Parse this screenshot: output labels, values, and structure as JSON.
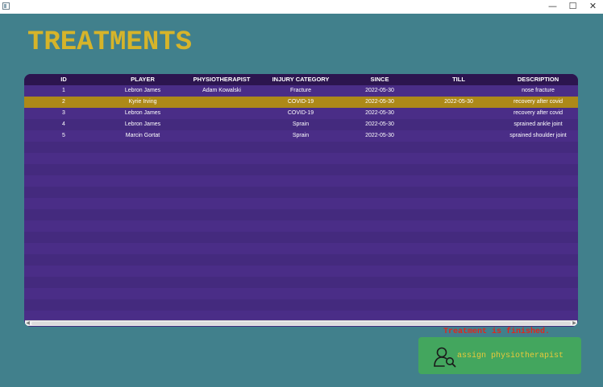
{
  "window": {
    "minimize_glyph": "—",
    "maximize_glyph": "☐",
    "close_glyph": "✕"
  },
  "page": {
    "title": "TREATMENTS"
  },
  "table": {
    "columns": [
      "ID",
      "PLAYER",
      "PHYSIOTHERAPIST",
      "INJURY CATEGORY",
      "SINCE",
      "TILL",
      "DESCRIPTION"
    ],
    "rows": [
      [
        "1",
        "Lebron James",
        "Adam Kowalski",
        "Fracture",
        "2022-05-30",
        "",
        "nose fracture"
      ],
      [
        "2",
        "Kyrie Irving",
        "",
        "COVID-19",
        "2022-05-30",
        "2022-05-30",
        "recovery after covid"
      ],
      [
        "3",
        "Lebron James",
        "",
        "COVID-19",
        "2022-05-30",
        "",
        "recovery after covid"
      ],
      [
        "4",
        "Lebron James",
        "",
        "Sprain",
        "2022-05-30",
        "",
        "sprained ankle joint"
      ],
      [
        "5",
        "Marcin Gortat",
        "",
        "Sprain",
        "2022-05-30",
        "",
        "sprained shoulder joint"
      ]
    ],
    "selected_row": 2
  },
  "status": {
    "message": "Treatment is finished.",
    "color": "#e0261e"
  },
  "actions": {
    "assign_label": "assign physiotherapist",
    "icon": "user-search-icon"
  },
  "colors": {
    "background": "#41808c",
    "table_bg": "#452c80",
    "header_bg": "#2c154f",
    "selected_row": "#ad8918",
    "title": "#d6b42a",
    "button_bg": "#43a65e",
    "button_text": "#e9c93a"
  }
}
